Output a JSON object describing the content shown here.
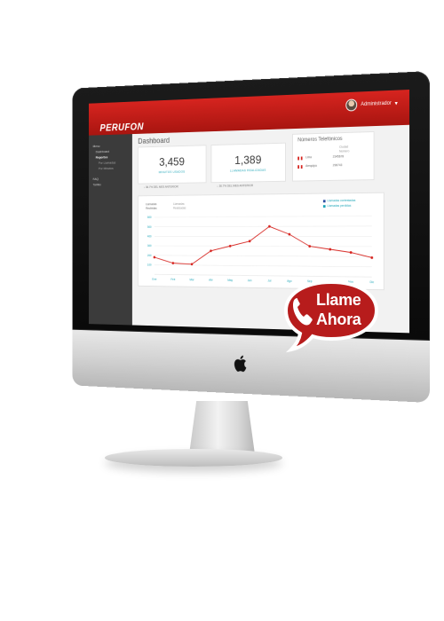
{
  "app": {
    "brand": "PERUFON",
    "user_name": "Administrador",
    "page_title": "Dashboard"
  },
  "sidebar": {
    "items": [
      {
        "label": "Menu",
        "level": 0
      },
      {
        "label": "Dashboard",
        "level": 1
      },
      {
        "label": "Reportes",
        "level": 1,
        "active": true
      },
      {
        "label": "Por Llamadas",
        "level": 2
      },
      {
        "label": "Por Minutos",
        "level": 2
      },
      {
        "label": "FAQ",
        "level": 0
      },
      {
        "label": "Tarifas",
        "level": 0
      }
    ]
  },
  "kpis": [
    {
      "value": "3,459",
      "label": "MINUTOS USADOS",
      "foot": "36.7% DEL MES ANTERIOR"
    },
    {
      "value": "1,389",
      "label": "LLAMADAS REALIZADAS",
      "foot": "36.7% DEL MES ANTERIOR"
    }
  ],
  "phones": {
    "title": "Números Telefónicos",
    "col_city": "Ciudad",
    "col_num": "Número",
    "rows": [
      {
        "city": "Lima",
        "number": "2345678"
      },
      {
        "city": "Arequipa",
        "number": "296743"
      }
    ]
  },
  "chart_tabs": [
    {
      "label": "Llamadas Recibidas",
      "active": true
    },
    {
      "label": "Llamadas Realizadas",
      "active": false
    }
  ],
  "legend": [
    {
      "label": "Llamadas contestadas",
      "color": "#2e4fa3"
    },
    {
      "label": "Llamadas perdidas",
      "color": "#1fa6b8"
    }
  ],
  "chart_data": {
    "type": "line",
    "title": "",
    "xlabel": "",
    "ylabel": "",
    "categories": [
      "Ene",
      "Feb",
      "Mar",
      "Abr",
      "May",
      "Jun",
      "Jul",
      "Ago",
      "Sep",
      "Oct",
      "Nov",
      "Dic"
    ],
    "ylim": [
      0,
      600
    ],
    "y_ticks": [
      "600",
      "500",
      "400",
      "300",
      "200",
      "100"
    ],
    "series": [
      {
        "values": [
          180,
          120,
          110,
          250,
          300,
          350,
          500,
          420,
          300,
          270,
          240,
          190
        ],
        "color": "#d6241f"
      }
    ],
    "grid": true
  },
  "badge": {
    "line1": "Llame",
    "line2": "Ahora",
    "color": "#b71c1c"
  },
  "icons": {
    "phone": "phone-icon",
    "apple": "apple-logo-icon",
    "user": "avatar"
  }
}
